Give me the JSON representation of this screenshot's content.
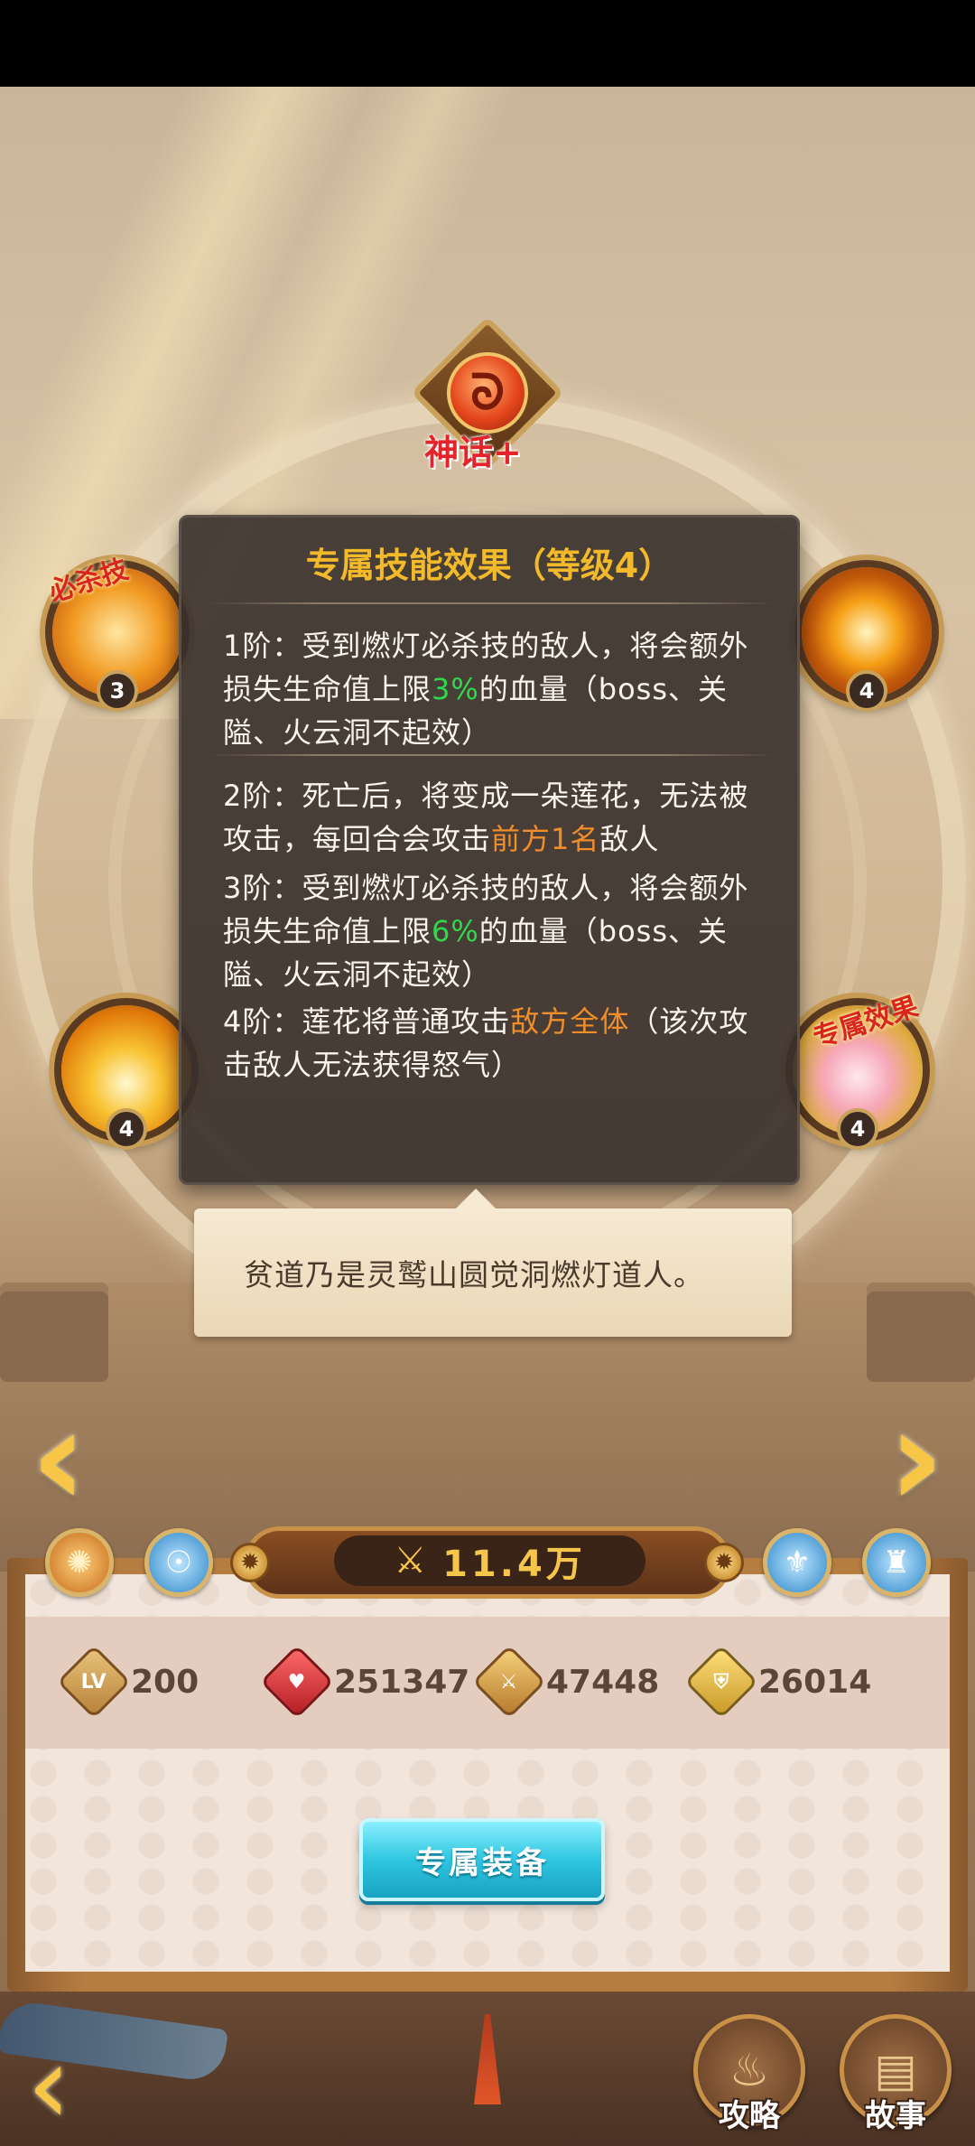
{
  "emblem": {
    "badge": "神话+",
    "glyph": "ᘐ"
  },
  "skills": [
    {
      "level": "3",
      "tag": "必杀技",
      "icon": "lotus-strike-icon"
    },
    {
      "level": "4",
      "tag": "",
      "icon": "swirl-icon"
    },
    {
      "level": "4",
      "tag": "",
      "icon": "flame-icon"
    },
    {
      "level": "4",
      "tag": "专属效果",
      "icon": "lotus-icon"
    }
  ],
  "tooltip": {
    "title": "专属技能效果（等级4）",
    "tier1": {
      "a": "1阶：受到燃灯必杀技的敌人，将会额外损失生命值上限",
      "hl": "3%",
      "b": "的血量（boss、关隘、火云洞不起效）"
    },
    "tier2": {
      "a": "2阶：死亡后，将变成一朵莲花，无法被攻击，每回合会攻击",
      "hl": "前方1名",
      "b": "敌人"
    },
    "tier3": {
      "a": "3阶：受到燃灯必杀技的敌人，将会额外损失生命值上限",
      "hl": "6%",
      "b": "的血量（boss、关隘、火云洞不起效）"
    },
    "tier4": {
      "a": "4阶：莲花将普通攻击",
      "hl": "敌方全体",
      "b": "（该次攻击敌人无法获得怒气）"
    }
  },
  "speech": "贫道乃是灵鹫山圆觉洞燃灯道人。",
  "power": {
    "value": "11.4万",
    "icon": "crossed-swords-icon"
  },
  "stats": {
    "level": {
      "icon_label": "LV",
      "value": "200"
    },
    "hp": {
      "value": "251347"
    },
    "attack": {
      "value": "47448"
    },
    "defense": {
      "value": "26014"
    }
  },
  "equip_button": "专属装备",
  "bottom": {
    "guide": "攻略",
    "story": "故事"
  },
  "colors": {
    "accent_gold": "#f2b92b",
    "highlight_green": "#2fd94b",
    "highlight_orange": "#f08e2b",
    "button_cyan": "#2fc6e0"
  }
}
